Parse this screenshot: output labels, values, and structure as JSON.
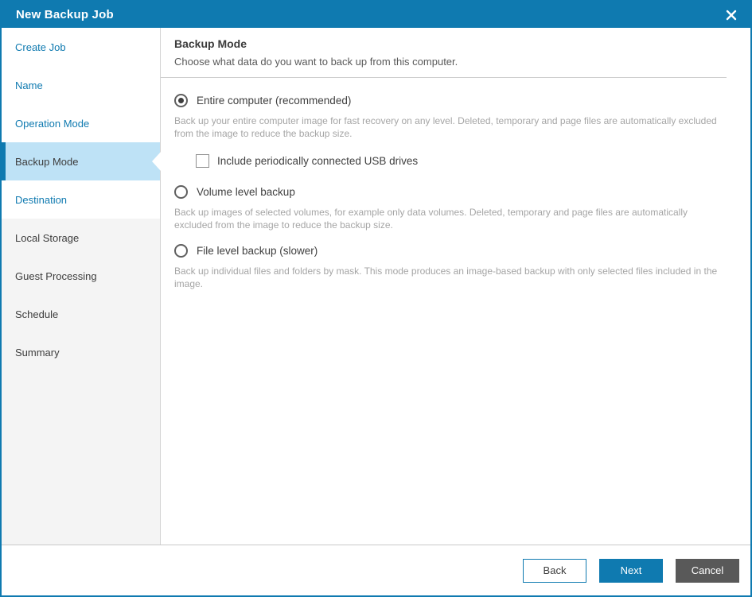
{
  "colors": {
    "accent": "#0f7ab0",
    "active_item_bg": "#bee2f6",
    "upcoming_item_bg": "#f4f4f4",
    "cancel_button_bg": "#595959"
  },
  "window": {
    "title": "New Backup Job"
  },
  "sidebar": {
    "items": [
      {
        "label": "Create Job",
        "state": "link"
      },
      {
        "label": "Name",
        "state": "link"
      },
      {
        "label": "Operation Mode",
        "state": "link"
      },
      {
        "label": "Backup Mode",
        "state": "active"
      },
      {
        "label": "Destination",
        "state": "link"
      },
      {
        "label": "Local Storage",
        "state": "upcoming"
      },
      {
        "label": "Guest Processing",
        "state": "upcoming"
      },
      {
        "label": "Schedule",
        "state": "upcoming"
      },
      {
        "label": "Summary",
        "state": "upcoming"
      }
    ]
  },
  "content": {
    "heading": "Backup Mode",
    "subheading": "Choose what data do you want to back up from this computer.",
    "options": [
      {
        "label": "Entire computer (recommended)",
        "selected": true,
        "description": "Back up your entire computer image for fast recovery on any level. Deleted, temporary and page files are automatically excluded from the image to reduce the backup size."
      },
      {
        "label": "Volume level backup",
        "selected": false,
        "description": "Back up images of selected volumes, for example only data volumes. Deleted, temporary and page files are automatically excluded from the image to reduce the backup size."
      },
      {
        "label": "File level backup (slower)",
        "selected": false,
        "description": "Back up individual files and folders by mask. This mode produces an image-based backup with only selected files included in the image."
      }
    ],
    "usb_checkbox": {
      "label": "Include periodically connected USB drives",
      "checked": false,
      "check_glyph": "✓"
    }
  },
  "footer": {
    "back_label": "Back",
    "next_label": "Next",
    "cancel_label": "Cancel"
  }
}
